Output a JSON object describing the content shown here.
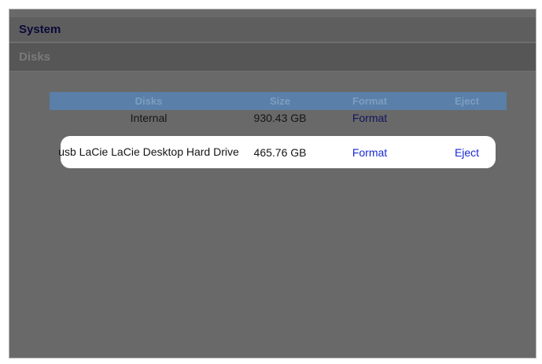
{
  "header": {
    "system_title": "System",
    "disks_title": "Disks"
  },
  "table": {
    "columns": [
      "Disks",
      "Size",
      "Format",
      "Eject"
    ],
    "rows": [
      {
        "name": "Internal",
        "size": "930.43 GB",
        "format": "Format",
        "eject": ""
      },
      {
        "name": "usb LaCie LaCie Desktop Hard Drive",
        "size": "465.76 GB",
        "format": "Format",
        "eject": "Eject"
      }
    ]
  },
  "colors": {
    "panel_bg": "#696969",
    "header_row_bg": "#5a7fa8",
    "link_blue": "#1a28d6",
    "highlight_row_bg": "#ffffff"
  }
}
